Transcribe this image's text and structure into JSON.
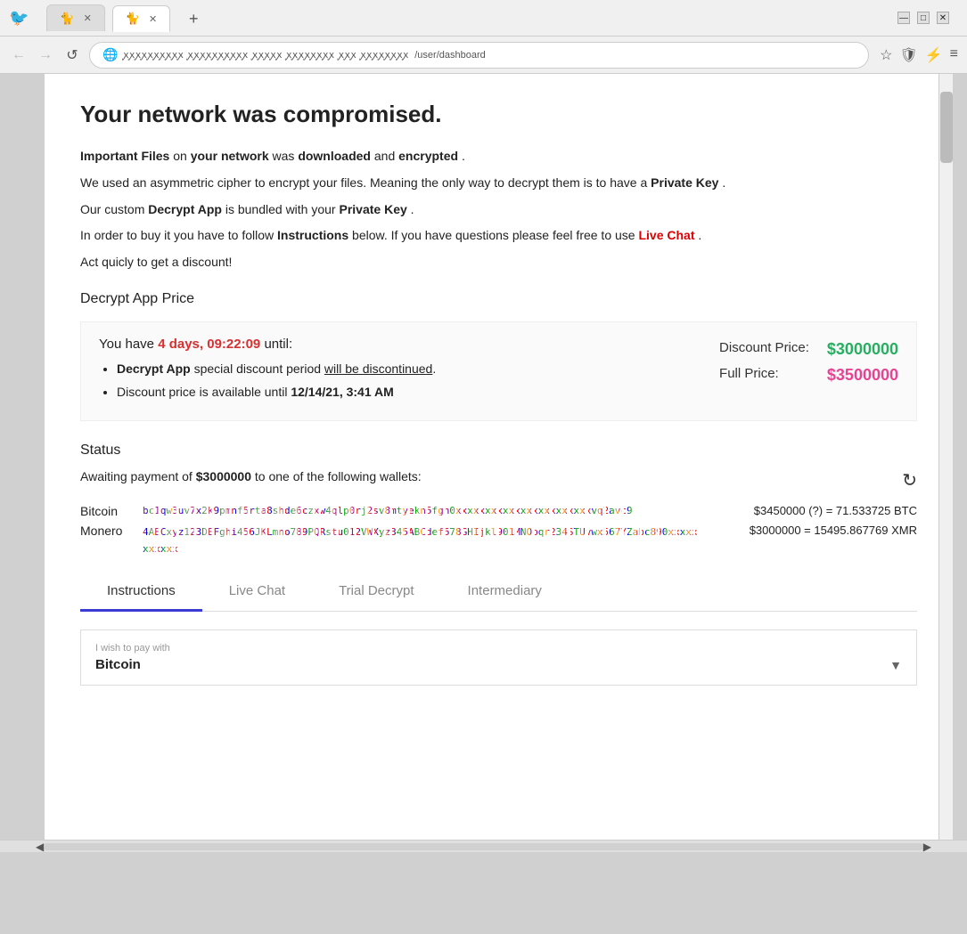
{
  "browser": {
    "tabs": [
      {
        "label": "",
        "icon": "🐈",
        "active": false,
        "closable": true
      },
      {
        "label": "",
        "icon": "🐈",
        "active": true,
        "closable": true
      }
    ],
    "address": "/user/dashboard",
    "address_prefix": "🌐 xxxxxxxxxxxxxxxxxx ... xxxxxxxxxx",
    "nav": {
      "back": "←",
      "forward": "→",
      "reload": "↺"
    }
  },
  "page": {
    "main_title": "Your network was compromised.",
    "intro": {
      "line1_parts": [
        {
          "text": "Important Files",
          "bold": true
        },
        {
          "text": " on "
        },
        {
          "text": "your network",
          "bold": true
        },
        {
          "text": " was "
        },
        {
          "text": "downloaded",
          "bold": true
        },
        {
          "text": " and "
        },
        {
          "text": "encrypted",
          "bold": true
        },
        {
          "text": "."
        }
      ],
      "line2": "We used an asymmetric cipher to encrypt your files. Meaning the only way to decrypt them is to have a ",
      "line2_end": "Private Key",
      "line3_start": "Our custom ",
      "line3_app": "Decrypt App",
      "line3_mid": " is bundled with your ",
      "line3_key": "Private Key",
      "line4_start": "In order to buy it you have to follow ",
      "line4_instructions": "Instructions",
      "line4_mid": " below. If you have questions please feel free to use ",
      "line4_live_chat": "Live Chat",
      "line5": "Act quicly to get a discount!"
    },
    "decrypt_app_price": {
      "section_title": "Decrypt App Price",
      "countdown_prefix": "You have ",
      "countdown_time": "4 days, 09:22:09",
      "countdown_suffix": " until:",
      "bullets": [
        {
          "text_bold": "Decrypt App",
          "text_rest": " special discount period ",
          "underline": "will be discontinued",
          "end": "."
        },
        {
          "text_prefix": "Discount price is available until ",
          "text_bold": "12/14/21, 3:41 AM"
        }
      ],
      "discount_label": "Discount Price:",
      "discount_value": "$3000000",
      "full_label": "Full Price:",
      "full_value": "$3500000"
    },
    "status": {
      "section_title": "Status",
      "awaiting_text": "Awaiting payment of ",
      "awaiting_amount": "$3000000",
      "awaiting_suffix": " to one of the following wallets:",
      "wallets": [
        {
          "label": "Bitcoin",
          "address": "bc1qxxxxxxxxxxxxxxxxxxxxxxxxxxxxxxxxxxxxxxxxxxxxxxxxxxxxxxxx",
          "amount": "$3450000 (?) = 71.533725 BTC"
        },
        {
          "label": "Monero",
          "address": "4xxxxxxxxxxxxxxxxxxxxxxxxxxxxxxxxxxxxxxxxxxxxxxxxxxxxxxxxxxxxxxxxxxxxxxxxxxxxxxxxxxxxxxxxxxxxxxxx",
          "amount": "$3000000 = 15495.867769 XMR"
        }
      ]
    },
    "tabs": [
      {
        "label": "Instructions",
        "active": true
      },
      {
        "label": "Live Chat",
        "active": false
      },
      {
        "label": "Trial Decrypt",
        "active": false
      },
      {
        "label": "Intermediary",
        "active": false
      }
    ],
    "payment": {
      "label": "I wish to pay with",
      "value": "Bitcoin",
      "dropdown_icon": "▼"
    }
  }
}
